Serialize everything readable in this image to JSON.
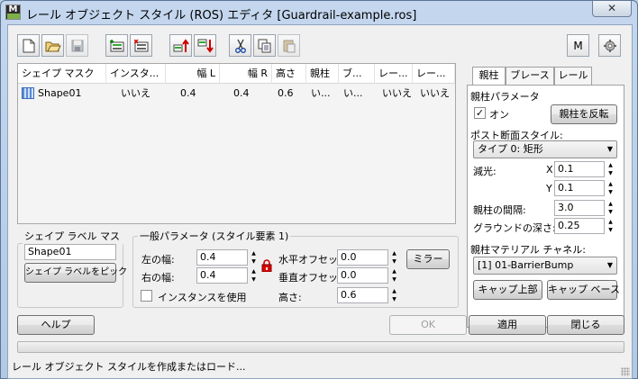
{
  "window": {
    "title": "レール オブジェクト スタイル (ROS) エディタ [Guardrail-example.ros]",
    "icon_letter": "M",
    "close_glyph": "✕"
  },
  "toolbar": {
    "buttons": [
      "new-icon",
      "open-icon",
      "save-icon",
      "add-shape-icon",
      "delete-shape-icon",
      "move-up-icon",
      "move-down-icon",
      "cut-icon",
      "copy-icon",
      "paste-icon"
    ],
    "m_label": "M"
  },
  "list": {
    "columns": [
      "シェイプ マスク",
      "インスタ...",
      "幅 L",
      "幅 R",
      "高さ",
      "親柱",
      "ブ...",
      "レー...",
      "レー..."
    ],
    "rows": [
      [
        "Shape01",
        "いいえ",
        "0.4",
        "0.4",
        "0.6",
        "い...",
        "い...",
        "いいえ",
        "いいえ"
      ]
    ]
  },
  "shape_label": {
    "legend": "シェイプ ラベル マスク",
    "value": "Shape01",
    "pick_button": "シェイプ ラベルをピック"
  },
  "general": {
    "legend": "一般パラメータ (スタイル要素 1)",
    "left_width_label": "左の幅:",
    "left_width": "0.4",
    "right_width_label": "右の幅:",
    "right_width": "0.4",
    "use_instance_label": "インスタンスを使用",
    "h_offset_label": "水平オフセット:",
    "h_offset": "0.0",
    "v_offset_label": "垂直オフセット:",
    "v_offset": "0.0",
    "height_label": "高さ:",
    "height": "0.6",
    "mirror_button": "ミラー"
  },
  "tabs": [
    "親柱",
    "ブレース",
    "レール"
  ],
  "post_params": {
    "title": "親柱パラメータ",
    "on_label": "オン",
    "on_checked": true,
    "reverse_button": "親柱を反転",
    "section_style_label": "ポスト断面スタイル:",
    "section_style_value": "タイプ 0: 矩形",
    "scale_label": "減光:",
    "x_label": "X",
    "x_value": "0.1",
    "y_label": "Y",
    "y_value": "0.1",
    "spacing_label": "親柱の間隔:",
    "spacing_value": "3.0",
    "ground_depth_label": "グラウンドの深さ:",
    "ground_depth_value": "0.25",
    "material_label": "親柱マテリアル チャネル:",
    "material_value": "[1] 01-BarrierBump",
    "cap_top_button": "キャップ上部",
    "cap_base_button": "キャップ ベース"
  },
  "footer": {
    "help_button": "ヘルプ",
    "ok_button": "OK",
    "apply_button": "適用",
    "close_button": "閉じる",
    "status": "レール オブジェクト スタイルを作成またはロード..."
  }
}
